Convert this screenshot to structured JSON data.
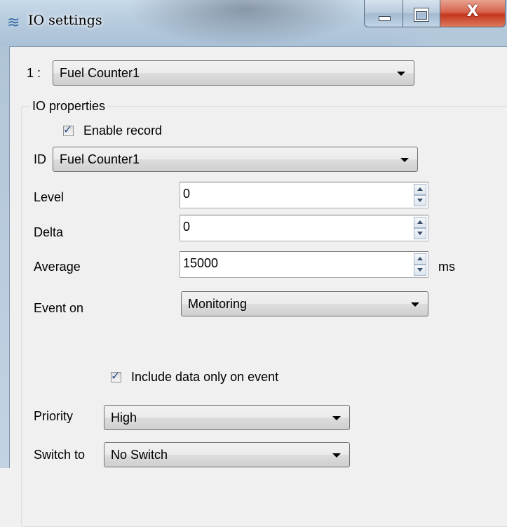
{
  "window": {
    "title": "IO settings",
    "icon": "wave-icon",
    "buttons": {
      "minimize": "minimize-icon",
      "maximize": "maximize-icon",
      "close": "close-icon",
      "close_glyph": "X"
    }
  },
  "io_index": {
    "label": "1 :",
    "selected": "Fuel Counter1"
  },
  "io_properties": {
    "title": "IO properties",
    "enable_record": {
      "label": "Enable record",
      "checked": true
    },
    "id": {
      "label": "ID",
      "selected": "Fuel Counter1"
    },
    "level": {
      "label": "Level",
      "value": "0"
    },
    "delta": {
      "label": "Delta",
      "value": "0"
    },
    "average": {
      "label": "Average",
      "value": "15000",
      "unit": "ms"
    },
    "event_on": {
      "label": "Event on",
      "selected": "Monitoring"
    },
    "include_data": {
      "label": "Include data only on event",
      "checked": true
    },
    "priority": {
      "label": "Priority",
      "selected": "High"
    },
    "switch_to": {
      "label": "Switch to",
      "selected": "No Switch"
    }
  },
  "colors": {
    "titlebar": "#b9cde0",
    "close_button": "#c3361d",
    "window_bg": "#f0f0f0",
    "check_mark": "#2a4f8c"
  }
}
